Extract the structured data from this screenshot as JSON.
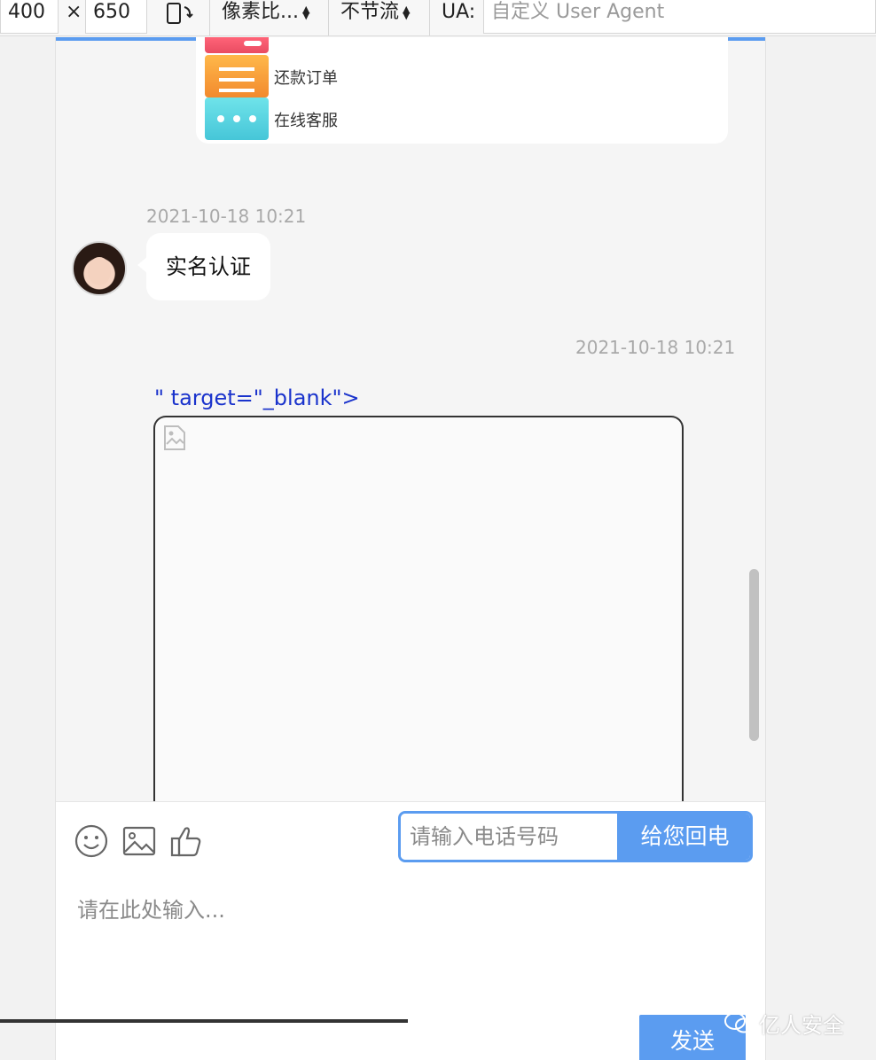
{
  "devtools": {
    "width_value": "400",
    "times": "×",
    "height_value": "650",
    "pixel_ratio_label": "像素比...",
    "throttle_label": "不节流",
    "ua_label": "UA:",
    "ua_placeholder": "自定义 User Agent"
  },
  "menu": {
    "items": [
      {
        "label": "还款订单",
        "icon": "list-icon"
      },
      {
        "label": "在线客服",
        "icon": "chat-dots-icon"
      }
    ]
  },
  "chat": {
    "messages": [
      {
        "timestamp": "2021-10-18 10:21",
        "side": "left",
        "text": "实名认证"
      },
      {
        "timestamp": "2021-10-18 10:21",
        "side": "right",
        "text": "\" target=\"_blank\">"
      }
    ]
  },
  "input_panel": {
    "tools": [
      "emoji-icon",
      "image-icon",
      "thumbs-up-icon"
    ],
    "phone_placeholder": "请输入电话号码",
    "callback_label": "给您回电",
    "message_placeholder": "请在此处输入...",
    "send_label": "发送"
  },
  "watermark": {
    "text": "亿人安全"
  },
  "colors": {
    "accent": "#5b9cf0",
    "link": "#1a33cc",
    "timestamp": "#a9a9a9"
  }
}
